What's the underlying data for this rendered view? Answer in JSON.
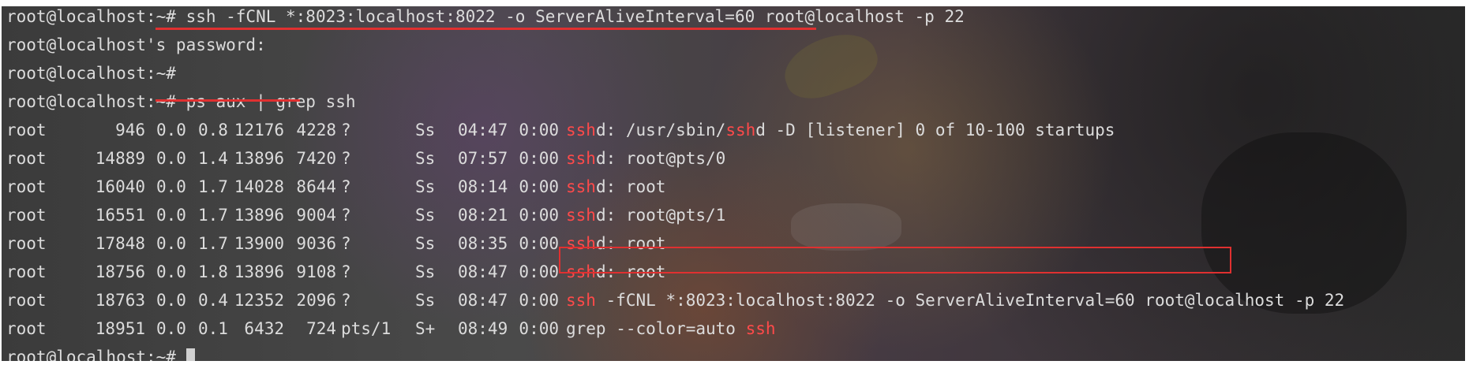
{
  "terminal": {
    "lines": [
      {
        "type": "command",
        "prompt": "root@localhost:~# ",
        "command": "ssh -fCNL *:8023:localhost:8022 -o ServerAliveInterval=60 root@localhost -p 22"
      },
      {
        "type": "text",
        "text": "root@localhost's password:"
      },
      {
        "type": "command",
        "prompt": "root@localhost:~#",
        "command": ""
      },
      {
        "type": "command",
        "prompt": "root@localhost:~# ",
        "command": "ps aux | grep ssh"
      }
    ],
    "process_rows": [
      {
        "user": "root",
        "pid": "946",
        "cpu": "0.0",
        "mem": "0.8",
        "vsz": "12176",
        "rss": "4228",
        "tty": "?",
        "stat": "Ss",
        "start": "04:47",
        "time": "0:00",
        "cmd": [
          {
            "t": "ssh",
            "hl": true
          },
          {
            "t": "d: /usr/sbin/",
            "hl": false
          },
          {
            "t": "ssh",
            "hl": true
          },
          {
            "t": "d -D [listener] 0 of 10-100 startups",
            "hl": false
          }
        ]
      },
      {
        "user": "root",
        "pid": "14889",
        "cpu": "0.0",
        "mem": "1.4",
        "vsz": "13896",
        "rss": "7420",
        "tty": "?",
        "stat": "Ss",
        "start": "07:57",
        "time": "0:00",
        "cmd": [
          {
            "t": "ssh",
            "hl": true
          },
          {
            "t": "d: root@pts/0",
            "hl": false
          }
        ]
      },
      {
        "user": "root",
        "pid": "16040",
        "cpu": "0.0",
        "mem": "1.7",
        "vsz": "14028",
        "rss": "8644",
        "tty": "?",
        "stat": "Ss",
        "start": "08:14",
        "time": "0:00",
        "cmd": [
          {
            "t": "ssh",
            "hl": true
          },
          {
            "t": "d: root",
            "hl": false
          }
        ]
      },
      {
        "user": "root",
        "pid": "16551",
        "cpu": "0.0",
        "mem": "1.7",
        "vsz": "13896",
        "rss": "9004",
        "tty": "?",
        "stat": "Ss",
        "start": "08:21",
        "time": "0:00",
        "cmd": [
          {
            "t": "ssh",
            "hl": true
          },
          {
            "t": "d: root@pts/1",
            "hl": false
          }
        ]
      },
      {
        "user": "root",
        "pid": "17848",
        "cpu": "0.0",
        "mem": "1.7",
        "vsz": "13900",
        "rss": "9036",
        "tty": "?",
        "stat": "Ss",
        "start": "08:35",
        "time": "0:00",
        "cmd": [
          {
            "t": "ssh",
            "hl": true
          },
          {
            "t": "d: root",
            "hl": false
          }
        ]
      },
      {
        "user": "root",
        "pid": "18756",
        "cpu": "0.0",
        "mem": "1.8",
        "vsz": "13896",
        "rss": "9108",
        "tty": "?",
        "stat": "Ss",
        "start": "08:47",
        "time": "0:00",
        "cmd": [
          {
            "t": "ssh",
            "hl": true
          },
          {
            "t": "d: root",
            "hl": false
          }
        ]
      },
      {
        "user": "root",
        "pid": "18763",
        "cpu": "0.0",
        "mem": "0.4",
        "vsz": "12352",
        "rss": "2096",
        "tty": "?",
        "stat": "Ss",
        "start": "08:47",
        "time": "0:00",
        "cmd": [
          {
            "t": "ssh",
            "hl": true
          },
          {
            "t": " -fCNL *:8023:localhost:8022 -o ServerAliveInterval=60 root@localhost -p 22",
            "hl": false
          }
        ]
      },
      {
        "user": "root",
        "pid": "18951",
        "cpu": "0.0",
        "mem": "0.1",
        "vsz": "6432",
        "rss": "724",
        "tty": "pts/1",
        "stat": "S+",
        "start": "08:49",
        "time": "0:00",
        "cmd": [
          {
            "t": "grep --color=auto ",
            "hl": false
          },
          {
            "t": "ssh",
            "hl": true
          }
        ]
      }
    ],
    "last_prompt": "root@localhost:~#"
  },
  "colors": {
    "text": "#dcdcdc",
    "match_highlight": "#ff4a4a",
    "annotation_red": "#e03030"
  }
}
